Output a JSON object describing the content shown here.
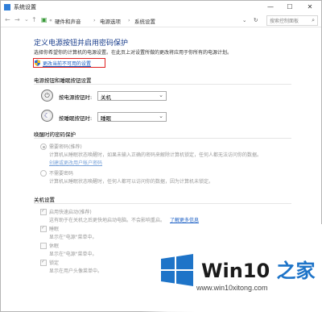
{
  "window": {
    "title": "系统设置",
    "minimize": "—",
    "maximize": "☐",
    "close": "✕"
  },
  "address": {
    "crumbs": [
      "硬件和声音",
      "电源选项",
      "系统设置"
    ],
    "search_placeholder": "搜索控制面板"
  },
  "header": {
    "title": "定义电源按钮并启用密码保护",
    "description": "选择你希望你的计算机的电源设置。在此页上对设置所做的更改将应用于你所有的电源计划。",
    "change_link": "更改当前不可用的设置"
  },
  "power_buttons": {
    "heading": "电源按钮和睡眠按钮设置",
    "power_label": "按电源按钮时:",
    "power_value": "关机",
    "sleep_label": "按睡眠按钮时:",
    "sleep_value": "睡眠"
  },
  "wake_password": {
    "heading": "唤醒时的密码保护",
    "require_label": "需要密码(推荐)",
    "require_desc": "计算机从睡眠状态唤醒时，如果未输入正确的密码来解除计算机锁定，任何人都无法访问你的数据。",
    "require_link": "创建或更改用户帐户密码",
    "no_require_label": "不需要密码",
    "no_require_desc": "计算机从睡眠状态唤醒时，任何人都可以访问你的数据，因为计算机未锁定。"
  },
  "shutdown": {
    "heading": "关机设置",
    "fast_label": "启用快速启动(推荐)",
    "fast_desc": "这有助于在关机之后更快地启动电脑。不会影响重启。",
    "learn_more": "了解更多信息",
    "sleep_label": "睡眠",
    "sleep_desc": "显示在\"电源\"菜单中。",
    "hibernate_label": "休眠",
    "hibernate_desc": "显示在\"电源\"菜单中。",
    "lock_label": "锁定",
    "lock_desc": "显示在用户头像菜单中。"
  },
  "watermark": {
    "brand_a": "Win10",
    "brand_b": " 之家",
    "url": "www.win10xitong.com"
  },
  "colors": {
    "heading": "#1a3e8c",
    "link": "#1a5ec4",
    "highlight_border": "#e02020",
    "windows_blue": "#1e74c8"
  }
}
